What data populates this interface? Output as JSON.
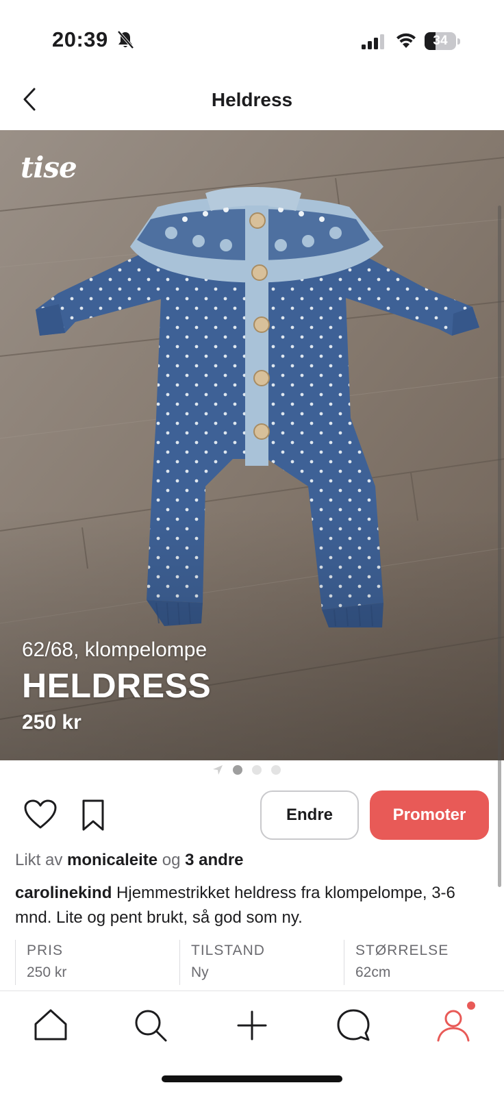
{
  "status_bar": {
    "time": "20:39",
    "battery_level": "34",
    "battery_fraction": 0.34
  },
  "header": {
    "title": "Heldress",
    "back_icon": "chevron-left-icon"
  },
  "photo": {
    "watermark": "tise",
    "overlay_subtitle": "62/68, klompelompe",
    "overlay_title": "HELDRESS",
    "overlay_price": "250 kr",
    "pagination": {
      "count": 3,
      "active_index": 0
    }
  },
  "actions": {
    "like_icon": "heart-icon",
    "save_icon": "bookmark-icon",
    "edit_label": "Endre",
    "promote_label": "Promoter"
  },
  "likes": {
    "prefix": "Likt av",
    "user": "monicaleite",
    "joiner": "og",
    "others": "3 andre"
  },
  "description": {
    "author": "carolinekind",
    "text": "Hjemmestrikket heldress fra klompelompe, 3-6 mnd. Lite og pent brukt, så god som ny."
  },
  "details": [
    {
      "label": "PRIS",
      "value": "250 kr"
    },
    {
      "label": "TILSTAND",
      "value": "Ny"
    },
    {
      "label": "STØRRELSE",
      "value": "62cm"
    }
  ],
  "tabbar": {
    "items": [
      "home-icon",
      "search-icon",
      "plus-icon",
      "chat-icon",
      "profile-icon"
    ],
    "active": "profile-icon",
    "has_notification": true
  },
  "colors": {
    "accent": "#e85a57",
    "text": "#1c1c1e",
    "muted": "#6b6b70",
    "knit_blue": "#3e6196",
    "knit_light": "#a9c2d8",
    "floor": "#8a7f74"
  }
}
